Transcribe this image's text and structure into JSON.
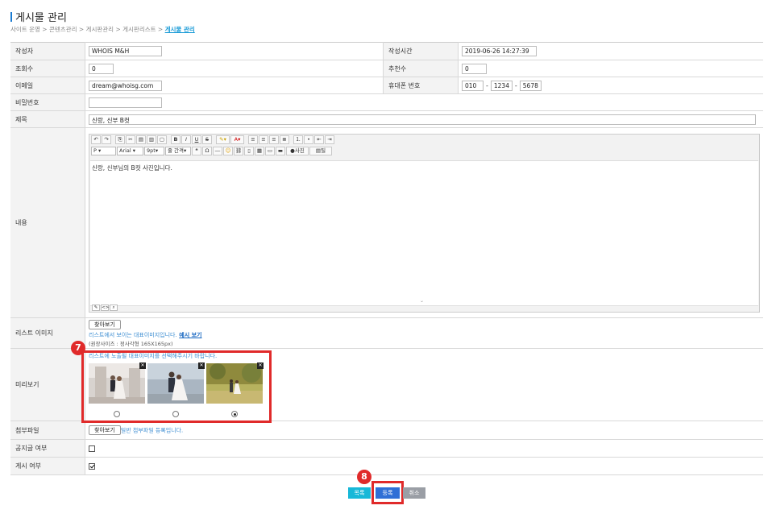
{
  "page": {
    "title": "게시물 관리"
  },
  "breadcrumb": {
    "items": [
      "사이트 운영",
      "콘텐츠관리",
      "게시판관리",
      "게시판리스트"
    ],
    "separator": ">",
    "current": "게시물 관리"
  },
  "form": {
    "author": {
      "label": "작성자",
      "value": "WHOIS M&H"
    },
    "created": {
      "label": "작성시간",
      "value": "2019-06-26 14:27:39"
    },
    "views": {
      "label": "조회수",
      "value": "0"
    },
    "recommend": {
      "label": "추천수",
      "value": "0"
    },
    "email": {
      "label": "이메일",
      "value": "dream@whoisg.com"
    },
    "phone": {
      "label": "휴대폰 번호",
      "part1": "010",
      "part2": "1234",
      "part3": "5678",
      "separator": "-"
    },
    "password": {
      "label": "비밀번호",
      "value": ""
    },
    "subject": {
      "label": "제목",
      "value": "신랑, 신부 B컷"
    },
    "content": {
      "label": "내용",
      "body": "신랑, 신부님의 B컷 사진입니다.",
      "toolbar": {
        "format": "P",
        "font": "Arial",
        "size": "9pt",
        "line_spacing": "줄 간격",
        "photo_label": "사진",
        "table_label": "틸"
      }
    },
    "list_image": {
      "label": "리스트 이미지",
      "button": "찾아보기",
      "hint": "리스트에서 보이는 대표이미지입니다.",
      "example_link": "예시 보기",
      "size_hint": "(권장사이즈 : 정사각형 165X165px)"
    },
    "preview": {
      "label": "미리보기",
      "hint": "리스트에 노출될 대표이미지를 선택해주시기 바랍니다.",
      "selected_index": 2,
      "image_count": 3
    },
    "attachment": {
      "label": "첨부파일",
      "button": "찾아보기",
      "hint": "일반 첨부파일 등록입니다."
    },
    "notice": {
      "label": "공지글 여부",
      "checked": false
    },
    "publish": {
      "label": "게시 여부",
      "checked": true
    }
  },
  "buttons": {
    "list": "목록",
    "submit": "등록",
    "cancel": "취소"
  },
  "annotations": {
    "badge_preview": "7",
    "badge_submit": "8",
    "highlight_color": "#e02a2a"
  },
  "colors": {
    "accent": "#1a9bd7",
    "list_button": "#17b8d8",
    "submit_button": "#2f6fd6",
    "cancel_button": "#9a9ea5"
  }
}
